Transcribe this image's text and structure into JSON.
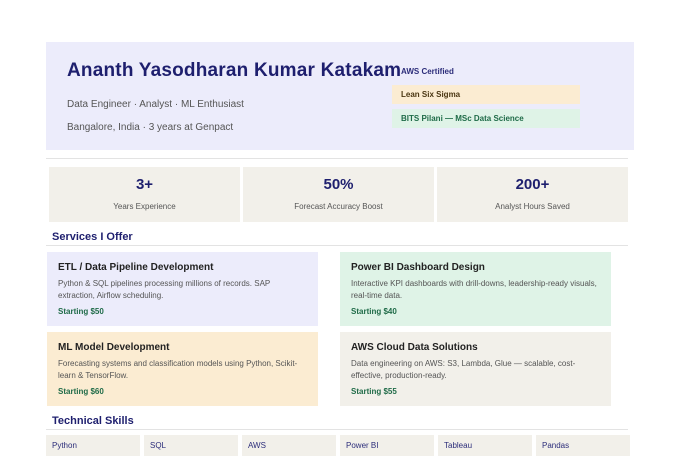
{
  "hero": {
    "name": "Ananth Yasodharan Kumar Katakam",
    "role": "Data Engineer · Analyst · ML Enthusiast",
    "location": "Bangalore, India · 3 years at Genpact",
    "badges": [
      "AWS Certified",
      "Lean Six Sigma",
      "BITS Pilani — MSc Data Science"
    ]
  },
  "stats": [
    {
      "value": "3+",
      "label": "Years Experience"
    },
    {
      "value": "50%",
      "label": "Forecast Accuracy Boost"
    },
    {
      "value": "200+",
      "label": "Analyst Hours Saved"
    }
  ],
  "services": {
    "title": "Services I Offer",
    "cards": [
      {
        "title": "ETL / Data Pipeline Development",
        "desc": "Python & SQL pipelines processing millions of records. SAP extraction, Airflow scheduling.",
        "price": "Starting $50"
      },
      {
        "title": "Power BI Dashboard Design",
        "desc": "Interactive KPI dashboards with drill-downs, leadership-ready visuals, real-time data.",
        "price": "Starting $40"
      },
      {
        "title": "ML Model Development",
        "desc": "Forecasting systems and classification models using Python, Scikit-learn & TensorFlow.",
        "price": "Starting $60"
      },
      {
        "title": "AWS Cloud Data Solutions",
        "desc": "Data engineering on AWS: S3, Lambda, Glue — scalable, cost-effective, production-ready.",
        "price": "Starting $55"
      }
    ]
  },
  "skills": {
    "title": "Technical Skills",
    "items": [
      "Python",
      "SQL",
      "AWS",
      "Power BI",
      "Tableau",
      "Pandas"
    ]
  },
  "colors": {
    "accent": "#1e1f6e",
    "hero_bg": "#ececfb",
    "card_purple": "#ececfb",
    "card_green": "#dff3e7",
    "card_orange": "#fbecd2",
    "card_beige": "#f2f0ea",
    "price_green": "#1f6b48"
  }
}
